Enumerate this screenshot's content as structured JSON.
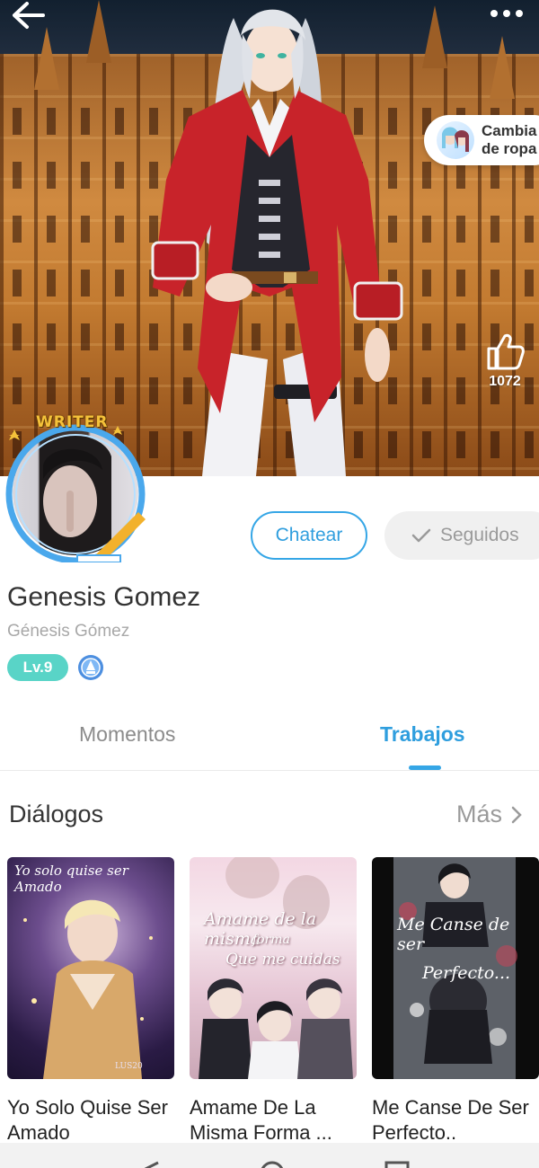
{
  "header": {
    "back_icon": "arrow-left-icon",
    "more_icon": "more-dots-icon",
    "outfit_button": "Cambia\nde ropa",
    "like_icon": "thumbs-up-icon",
    "like_count": "1072"
  },
  "profile": {
    "badge_label": "WRITER",
    "name": "Genesis Gomez",
    "username": "Génesis Gómez",
    "level": "Lv.9",
    "chat_button": "Chatear",
    "follow_button": "Seguidos"
  },
  "tabs": [
    {
      "label": "Momentos",
      "active": false
    },
    {
      "label": "Trabajos",
      "active": true
    }
  ],
  "section": {
    "title": "Diálogos",
    "more_label": "Más"
  },
  "works": [
    {
      "title": "Yo Solo Quise Ser Amado",
      "cover_text": "Yo solo quise ser Amado",
      "cover_credit": "LUS20"
    },
    {
      "title": "Amame De La Misma Forma ...",
      "cover_text_1": "Amame de la misma",
      "cover_text_2": "forma",
      "cover_text_3": "Que me cuidas"
    },
    {
      "title": "Me Canse De Ser Perfecto..",
      "cover_text_1": "Me Canse de ser",
      "cover_text_2": "Perfecto..."
    }
  ],
  "colors": {
    "accent": "#35a6e6",
    "level_badge": "#59d4c7",
    "follow_bg": "#f0f0f0"
  }
}
